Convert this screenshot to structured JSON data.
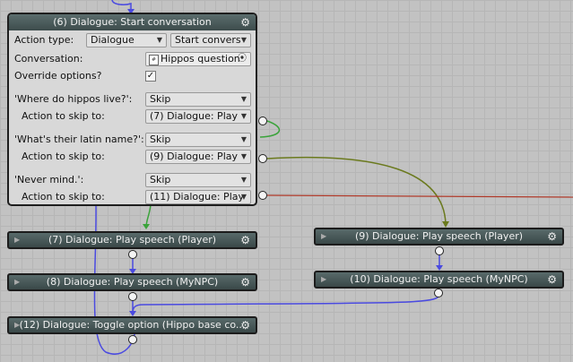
{
  "main_node": {
    "title": "(6) Dialogue: Start conversation",
    "action_type_label": "Action type:",
    "action_type_value": "Dialogue",
    "action_subtype_value": "Start convers",
    "conversation_label": "Conversation:",
    "conversation_value": "Hippos question",
    "override_label": "Override options?",
    "override_checked": "✓",
    "options": [
      {
        "label": "'Where do hippos live?':",
        "choice": "Skip",
        "skip_label": "Action to skip to:",
        "skip_value": "(7) Dialogue: Play"
      },
      {
        "label": "'What's their latin name?':",
        "choice": "Skip",
        "skip_label": "Action to skip to:",
        "skip_value": "(9) Dialogue: Play"
      },
      {
        "label": "'Never mind.':",
        "choice": "Skip",
        "skip_label": "Action to skip to:",
        "skip_value": "(11) Dialogue: Play"
      }
    ]
  },
  "nodes": [
    {
      "title": "(7) Dialogue: Play speech (Player)"
    },
    {
      "title": "(8) Dialogue: Play speech (MyNPC)"
    },
    {
      "title": "(9) Dialogue: Play speech (Player)"
    },
    {
      "title": "(10) Dialogue: Play speech (MyNPC)"
    },
    {
      "title": "(12) Dialogue: Toggle option (Hippo base co..."
    }
  ],
  "colors": {
    "wire_blue": "#4a4ae0",
    "wire_green": "#3aa33a",
    "wire_olive": "#6b7a1e",
    "wire_red": "#b03a2a"
  },
  "icons": {
    "gear": "⚙",
    "arrow": "▶",
    "caret": "▼",
    "target": "⦿"
  }
}
